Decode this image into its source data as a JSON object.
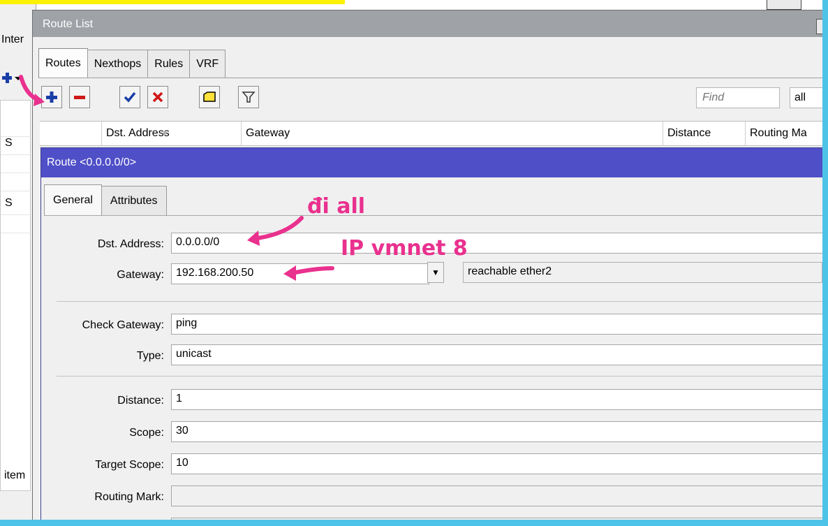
{
  "background_window": {
    "label_partial": "Inter",
    "rows": [
      "S",
      "S"
    ],
    "items_label": "item"
  },
  "route_list": {
    "title": "Route List",
    "tabs": [
      {
        "label": "Routes",
        "active": true
      },
      {
        "label": "Nexthops",
        "active": false
      },
      {
        "label": "Rules",
        "active": false
      },
      {
        "label": "VRF",
        "active": false
      }
    ],
    "toolbar": {
      "add_icon": "plus-icon",
      "remove_icon": "minus-icon",
      "enable_icon": "check-icon",
      "disable_icon": "x-icon",
      "comment_icon": "comment-icon",
      "filter_icon": "filter-icon",
      "find_placeholder": "Find",
      "filter_value": "all"
    },
    "columns": [
      "Dst. Address",
      "Gateway",
      "Distance",
      "Routing Ma"
    ]
  },
  "route_dialog": {
    "title": "Route <0.0.0.0/0>",
    "tabs": [
      {
        "label": "General",
        "active": true
      },
      {
        "label": "Attributes",
        "active": false
      }
    ],
    "fields": {
      "dst_address": {
        "label": "Dst. Address:",
        "value": "0.0.0.0/0"
      },
      "gateway": {
        "label": "Gateway:",
        "value": "192.168.200.50",
        "status": "reachable ether2"
      },
      "check_gateway": {
        "label": "Check Gateway:",
        "value": "ping"
      },
      "type": {
        "label": "Type:",
        "value": "unicast"
      },
      "distance": {
        "label": "Distance:",
        "value": "1"
      },
      "scope": {
        "label": "Scope:",
        "value": "30"
      },
      "target_scope": {
        "label": "Target Scope:",
        "value": "10"
      },
      "routing_mark": {
        "label": "Routing Mark:",
        "value": ""
      }
    }
  },
  "annotations": {
    "note_all": "đi all",
    "note_vmnet": "IP vmnet 8",
    "color": "#e9318e"
  },
  "colors": {
    "dialog_title_bar": "#4f4fc8",
    "list_title_bar": "#9fa3a8",
    "frame_cyan": "#4ec3e8",
    "highlight_yellow": "#fbf100"
  }
}
